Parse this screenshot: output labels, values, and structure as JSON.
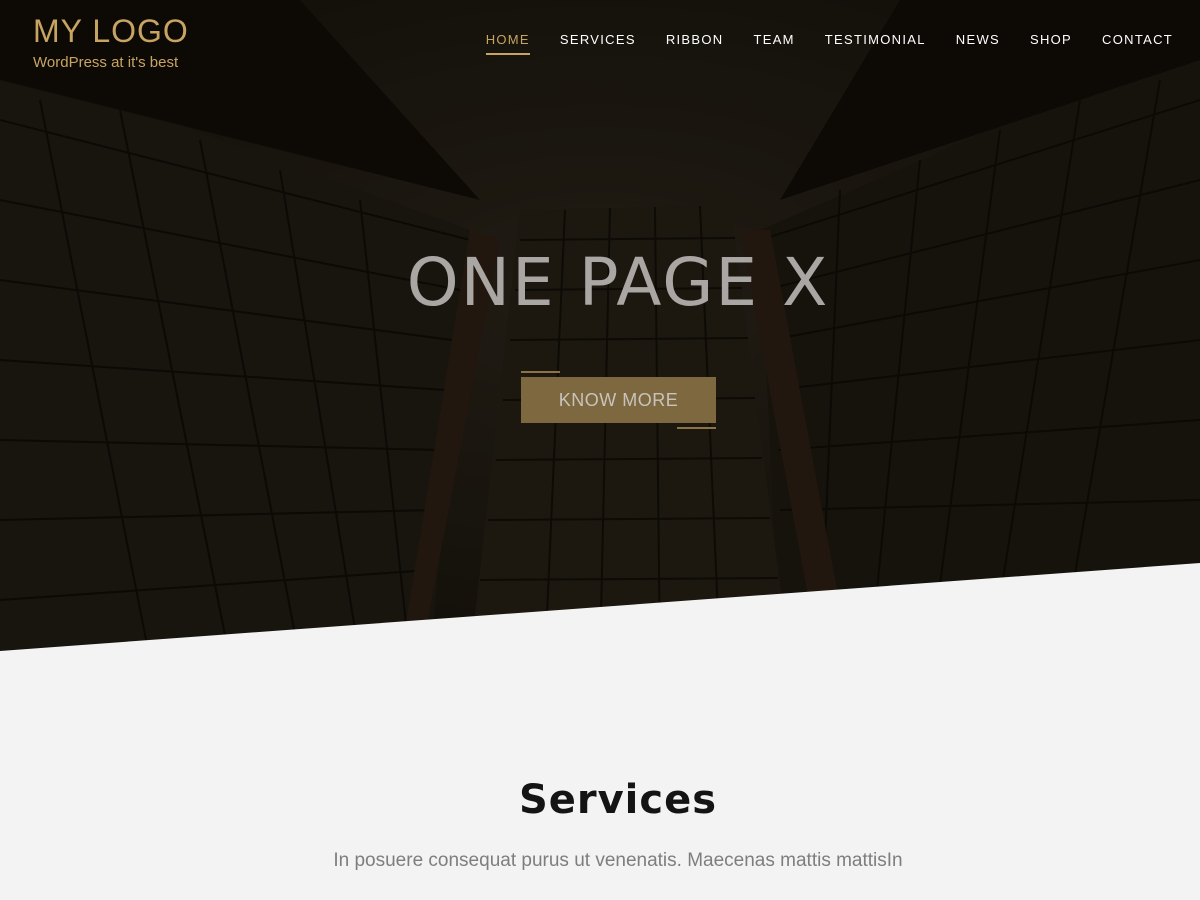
{
  "brand": {
    "title": "MY LOGO",
    "tagline": "WordPress at it's best"
  },
  "nav": {
    "items": [
      {
        "label": "HOME",
        "active": true
      },
      {
        "label": "SERVICES",
        "active": false
      },
      {
        "label": "RIBBON",
        "active": false
      },
      {
        "label": "TEAM",
        "active": false
      },
      {
        "label": "TESTIMONIAL",
        "active": false
      },
      {
        "label": "NEWS",
        "active": false
      },
      {
        "label": "SHOP",
        "active": false
      },
      {
        "label": "CONTACT",
        "active": false
      }
    ]
  },
  "hero": {
    "title": "ONE PAGE X",
    "cta_label": "KNOW MORE"
  },
  "services": {
    "title": "Services",
    "subtitle": "In posuere consequat purus ut venenatis. Maecenas mattis mattisIn"
  },
  "colors": {
    "accent": "#c7a462",
    "button": "#7d6840",
    "background": "#f3f3f3",
    "hero_dark": "#14110c"
  }
}
